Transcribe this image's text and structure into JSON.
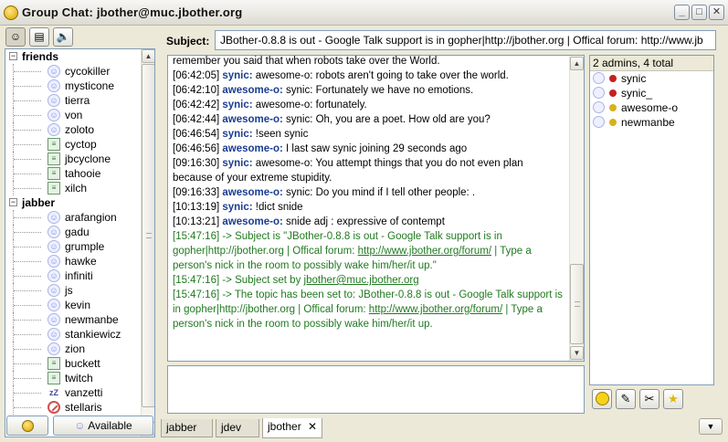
{
  "window": {
    "title": "Group Chat: jbother@muc.jbother.org",
    "minimize": "_",
    "maximize": "□",
    "close": "✕"
  },
  "roster_toolbar": {
    "status_icon": "smiley-icon",
    "busy_icon": "busy-icon",
    "sound_icon": "speaker-icon"
  },
  "roster": {
    "groups": [
      {
        "name": "friends",
        "toggle": "−",
        "contacts": [
          {
            "name": "cycokiller",
            "status": "online"
          },
          {
            "name": "mysticone",
            "status": "online"
          },
          {
            "name": "tierra",
            "status": "online"
          },
          {
            "name": "von",
            "status": "online"
          },
          {
            "name": "zoloto",
            "status": "online"
          },
          {
            "name": "cyctop",
            "status": "busy"
          },
          {
            "name": "jbcyclone",
            "status": "busy"
          },
          {
            "name": "tahooie",
            "status": "busy"
          },
          {
            "name": "xilch",
            "status": "busy"
          }
        ]
      },
      {
        "name": "jabber",
        "toggle": "−",
        "contacts": [
          {
            "name": "arafangion",
            "status": "online"
          },
          {
            "name": "gadu",
            "status": "online"
          },
          {
            "name": "grumple",
            "status": "online"
          },
          {
            "name": "hawke",
            "status": "online"
          },
          {
            "name": "infiniti",
            "status": "online"
          },
          {
            "name": "js",
            "status": "online"
          },
          {
            "name": "kevin",
            "status": "online"
          },
          {
            "name": "newmanbe",
            "status": "online"
          },
          {
            "name": "stankiewicz",
            "status": "online"
          },
          {
            "name": "zion",
            "status": "online"
          },
          {
            "name": "buckett",
            "status": "busy"
          },
          {
            "name": "twitch",
            "status": "busy"
          },
          {
            "name": "vanzetti",
            "status": "away"
          },
          {
            "name": "stellaris",
            "status": "dnd"
          }
        ]
      }
    ]
  },
  "roster_footer": {
    "status_button_icon": "bulb-icon",
    "available_label": "Available"
  },
  "subject": {
    "label": "Subject:",
    "value": "JBother-0.8.8 is out - Google Talk support is in gopher|http://jbother.org | Offical forum: http://www.jb"
  },
  "chat": {
    "messages": [
      {
        "type": "cut",
        "text": "remember you said that when robots take over the World."
      },
      {
        "type": "msg",
        "time": "[06:42:05]",
        "nick": "synic:",
        "text": " awesome-o: robots aren't going to take over the world."
      },
      {
        "type": "msg",
        "time": "[06:42:10]",
        "nick": "awesome-o:",
        "text": " synic: Fortunately we have no emotions."
      },
      {
        "type": "msg",
        "time": "[06:42:42]",
        "nick": "synic:",
        "text": " awesome-o: fortunately."
      },
      {
        "type": "msg",
        "time": "[06:42:44]",
        "nick": "awesome-o:",
        "text": " synic: Oh, you are a poet. How old are you?"
      },
      {
        "type": "msg",
        "time": "[06:46:54]",
        "nick": "synic:",
        "text": " !seen synic"
      },
      {
        "type": "msg",
        "time": "[06:46:56]",
        "nick": "awesome-o:",
        "text": " I last saw synic joining 29 seconds ago"
      },
      {
        "type": "msg",
        "time": "[09:16:30]",
        "nick": "synic:",
        "text": " awesome-o: You attempt things that you do not even plan because of your extreme stupidity."
      },
      {
        "type": "msg",
        "time": "[09:16:33]",
        "nick": "awesome-o:",
        "text": " synic: Do you mind if I tell other people: ."
      },
      {
        "type": "msg",
        "time": "[10:13:19]",
        "nick": "synic:",
        "text": " !dict snide"
      },
      {
        "type": "msg",
        "time": "[10:13:21]",
        "nick": "awesome-o:",
        "text": " snide adj : expressive of contempt"
      }
    ],
    "sys1_time": "[15:47:16]",
    "sys1_a": " -> Subject is \"JBother-0.8.8 is out - Google Talk support is in gopher|http://jbother.org | Offical forum: ",
    "sys1_link": "http://www.jbother.org/forum/",
    "sys1_b": " | Type a person's nick in the room to possibly wake him/her/it up.\"",
    "sys2_time": "[15:47:16]",
    "sys2_a": " -> Subject set by ",
    "sys2_link": "jbother@muc.jbother.org",
    "sys3_time": "[15:47:16]",
    "sys3_a": " -> The topic has been set to: JBother-0.8.8 is out - Google Talk support is in gopher|http://jbother.org | Offical forum: ",
    "sys3_link": "http://www.jbother.org/forum/",
    "sys3_b": " | Type a person's nick in the room to possibly wake him/her/it up."
  },
  "occupants": {
    "summary": "2 admins, 4 total",
    "list": [
      {
        "name": "synic",
        "role_color": "#c42020"
      },
      {
        "name": "synic_",
        "role_color": "#c42020"
      },
      {
        "name": "awesome-o",
        "role_color": "#d6b21c"
      },
      {
        "name": "newmanbe",
        "role_color": "#d6b21c"
      }
    ]
  },
  "occupant_toolbar": [
    "emoticon-icon",
    "edit-icon",
    "tools-icon",
    "star-icon"
  ],
  "tabs": [
    {
      "label": "jabber",
      "active": false
    },
    {
      "label": "jdev",
      "active": false
    },
    {
      "label": "jbother",
      "active": true,
      "close": "✕"
    }
  ],
  "tab_menu": "▼"
}
